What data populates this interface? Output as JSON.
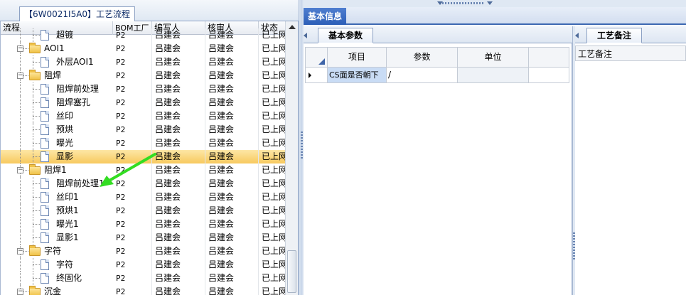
{
  "left_panel": {
    "tab_label": "【6W0021I5A0】工艺流程",
    "columns": [
      "流程",
      "BOM工厂",
      "编写人",
      "核审人",
      "状态"
    ],
    "rows": [
      {
        "name": "超镀",
        "bom": "P2",
        "writer": "吕建会",
        "reviewer": "吕建会",
        "status": "已上网",
        "level": 2,
        "type": "doc",
        "selected": false
      },
      {
        "name": "AOI1",
        "bom": "P2",
        "writer": "吕建会",
        "reviewer": "吕建会",
        "status": "已上网",
        "level": 1,
        "type": "folder",
        "selected": false
      },
      {
        "name": "外层AOI1",
        "bom": "P2",
        "writer": "吕建会",
        "reviewer": "吕建会",
        "status": "已上网",
        "level": 2,
        "type": "doc",
        "selected": false
      },
      {
        "name": "阻焊",
        "bom": "P2",
        "writer": "吕建会",
        "reviewer": "吕建会",
        "status": "已上网",
        "level": 1,
        "type": "folder",
        "selected": false
      },
      {
        "name": "阻焊前处理",
        "bom": "P2",
        "writer": "吕建会",
        "reviewer": "吕建会",
        "status": "已上网",
        "level": 2,
        "type": "doc",
        "selected": false
      },
      {
        "name": "阻焊塞孔",
        "bom": "P2",
        "writer": "吕建会",
        "reviewer": "吕建会",
        "status": "已上网",
        "level": 2,
        "type": "doc",
        "selected": false
      },
      {
        "name": "丝印",
        "bom": "P2",
        "writer": "吕建会",
        "reviewer": "吕建会",
        "status": "已上网",
        "level": 2,
        "type": "doc",
        "selected": false
      },
      {
        "name": "预烘",
        "bom": "P2",
        "writer": "吕建会",
        "reviewer": "吕建会",
        "status": "已上网",
        "level": 2,
        "type": "doc",
        "selected": false
      },
      {
        "name": "曝光",
        "bom": "P2",
        "writer": "吕建会",
        "reviewer": "吕建会",
        "status": "已上网",
        "level": 2,
        "type": "doc",
        "selected": false
      },
      {
        "name": "显影",
        "bom": "P2",
        "writer": "吕建会",
        "reviewer": "吕建会",
        "status": "已上网",
        "level": 2,
        "type": "doc",
        "selected": true
      },
      {
        "name": "阻焊1",
        "bom": "P2",
        "writer": "吕建会",
        "reviewer": "吕建会",
        "status": "已上网",
        "level": 1,
        "type": "folder",
        "selected": false
      },
      {
        "name": "阻焊前处理1",
        "bom": "P2",
        "writer": "吕建会",
        "reviewer": "吕建会",
        "status": "已上网",
        "level": 2,
        "type": "doc",
        "selected": false
      },
      {
        "name": "丝印1",
        "bom": "P2",
        "writer": "吕建会",
        "reviewer": "吕建会",
        "status": "已上网",
        "level": 2,
        "type": "doc",
        "selected": false
      },
      {
        "name": "预烘1",
        "bom": "P2",
        "writer": "吕建会",
        "reviewer": "吕建会",
        "status": "已上网",
        "level": 2,
        "type": "doc",
        "selected": false
      },
      {
        "name": "曝光1",
        "bom": "P2",
        "writer": "吕建会",
        "reviewer": "吕建会",
        "status": "已上网",
        "level": 2,
        "type": "doc",
        "selected": false
      },
      {
        "name": "显影1",
        "bom": "P2",
        "writer": "吕建会",
        "reviewer": "吕建会",
        "status": "已上网",
        "level": 2,
        "type": "doc",
        "selected": false
      },
      {
        "name": "字符",
        "bom": "P2",
        "writer": "吕建会",
        "reviewer": "吕建会",
        "status": "已上网",
        "level": 1,
        "type": "folder",
        "selected": false
      },
      {
        "name": "字符",
        "bom": "P2",
        "writer": "吕建会",
        "reviewer": "吕建会",
        "status": "已上网",
        "level": 2,
        "type": "doc",
        "selected": false
      },
      {
        "name": "终固化",
        "bom": "P2",
        "writer": "吕建会",
        "reviewer": "吕建会",
        "status": "已上网",
        "level": 2,
        "type": "doc",
        "selected": false
      },
      {
        "name": "沉金",
        "bom": "P2",
        "writer": "吕建会",
        "reviewer": "吕建会",
        "status": "已上网",
        "level": 1,
        "type": "folder",
        "selected": false
      }
    ]
  },
  "info": {
    "tab_label": "基本信息",
    "params_tab": "基本参数",
    "params_columns": [
      "项目",
      "参数",
      "单位"
    ],
    "params_rows": [
      {
        "item": "CS面是否朝下",
        "value": "/",
        "unit": ""
      }
    ],
    "notes_tab": "工艺备注",
    "notes_label": "工艺备注"
  },
  "colors": {
    "selected_row": "#f7c95e",
    "active_tab": "#2d5fb8",
    "annotation_arrow": "#33dd22"
  }
}
